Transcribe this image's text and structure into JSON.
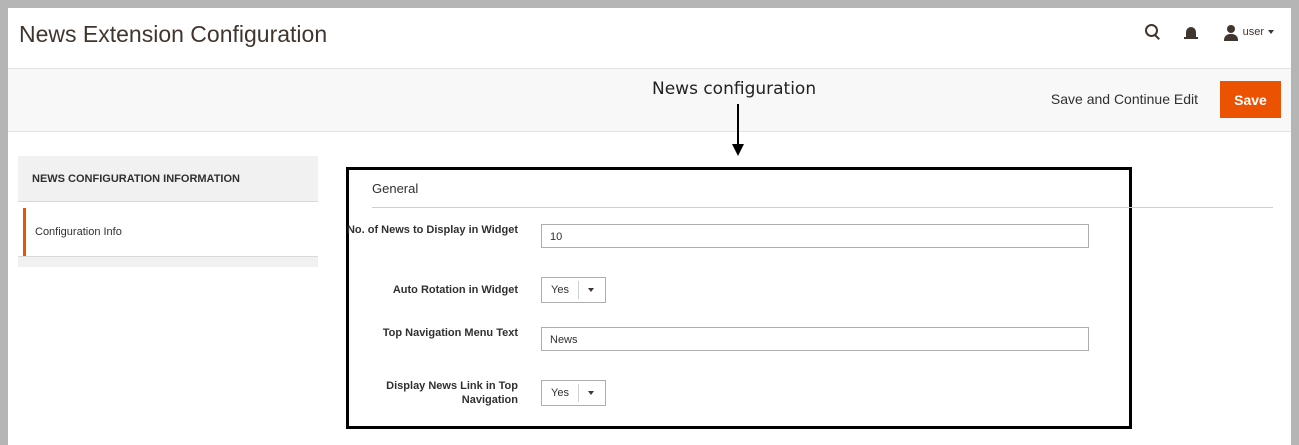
{
  "page": {
    "title": "News Extension Configuration",
    "user_label": "user"
  },
  "actions": {
    "save_continue_label": "Save and Continue Edit",
    "save_label": "Save"
  },
  "annotation": {
    "label": "News configuration"
  },
  "sidebar": {
    "title": "NEWS CONFIGURATION INFORMATION",
    "items": [
      {
        "label": "Configuration Info"
      }
    ]
  },
  "section": {
    "title": "General",
    "fields": [
      {
        "label": "No. of News to Display in Widget",
        "type": "text",
        "value": "10"
      },
      {
        "label": "Auto Rotation in Widget",
        "type": "select",
        "value": "Yes"
      },
      {
        "label": "Top Navigation Menu Text",
        "type": "text",
        "value": "News"
      },
      {
        "label": "Display News Link in Top Navigation",
        "type": "select",
        "value": "Yes"
      }
    ]
  },
  "colors": {
    "accent": "#eb5202",
    "header_text": "#41362f",
    "actions_bar_bg": "#f8f8f8"
  }
}
